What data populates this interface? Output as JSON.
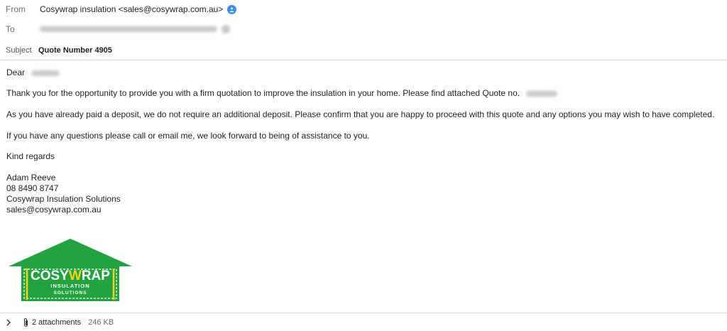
{
  "header": {
    "from_label": "From",
    "from_value": "Cosywrap insulation <sales@cosywrap.com.au>",
    "to_label": "To",
    "subject_label": "Subject",
    "subject_value": "Quote Number 4905"
  },
  "body": {
    "greeting": "Dear",
    "para1": "Thank you for the opportunity to provide you with a firm quotation to improve the insulation in your home. Please find attached Quote no.",
    "para2": "As you have already paid a deposit, we do not require an additional deposit. Please confirm that you are happy to proceed with this quote and any options you may wish to have completed.",
    "para3": "If you have any questions please call or email me, we look forward to being of assistance to you.",
    "closing": "Kind regards"
  },
  "signature": {
    "name": "Adam Reeve",
    "phone": "08 8490 8747",
    "company": "Cosywrap Insulation Solutions",
    "email": "sales@cosywrap.com.au"
  },
  "logo": {
    "word_cosy": "COSY",
    "word_w": "W",
    "word_rap": "RAP",
    "line1": "INSULATION",
    "line2": "SOLUTIONS",
    "brand_green": "#22a340",
    "accent_yellow": "#f2d21b"
  },
  "footer": {
    "attachments_label": "2 attachments",
    "attachments_size": "246 KB"
  },
  "icons": [
    "info-icon",
    "chevron-right-icon",
    "paperclip-icon"
  ]
}
